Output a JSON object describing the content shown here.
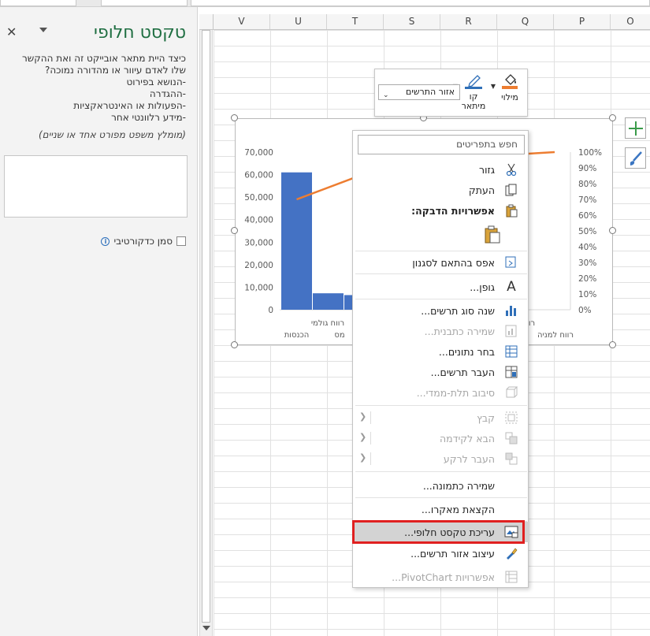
{
  "pane": {
    "title": "טקסט חלופי",
    "description_lines": [
      "כיצד היית מתאר אובייקט זה ואת ההקשר",
      "שלו לאדם עיוור או מהדורה נמוכה?",
      "-הנושא בפירוט",
      "-ההגדרה",
      "-הפעולות או האינטראקציות",
      "-מידע רלוונטי אחר"
    ],
    "hint": "(מומלץ משפט מפורט אחד או שניים)",
    "decorative_label": "סמן כדקורטיבי",
    "close_glyph": "✕"
  },
  "columns": [
    "V",
    "U",
    "T",
    "S",
    "R",
    "Q",
    "P",
    "O"
  ],
  "mini_toolbar": {
    "fill_label": "מילוי",
    "outline_label_1": "קו",
    "outline_label_2": "מיתאר",
    "element_select": "אזור התרשים"
  },
  "chart_data": {
    "type": "bar",
    "categories": [
      "הכנסות",
      "רווח גולמי",
      "מס",
      "רווח למניה"
    ],
    "values": [
      61000,
      7300,
      6500,
      null
    ],
    "line_series": {
      "values": [
        0.7,
        0.85,
        0.95,
        1.0
      ]
    },
    "ylim": [
      0,
      70000
    ],
    "y_ticks": [
      "0",
      "10,000",
      "20,000",
      "30,000",
      "40,000",
      "50,000",
      "60,000",
      "70,000"
    ],
    "y2_ticks": [
      "0%",
      "10%",
      "20%",
      "30%",
      "40%",
      "50%",
      "60%",
      "70%",
      "80%",
      "90%",
      "100%"
    ],
    "x_labels_visible": [
      "הכנסות",
      "רווח גולמי",
      "מס",
      "רווח למניה",
      "רו"
    ],
    "bar_color": "#4472c4",
    "line_color": "#ed7d31"
  },
  "context_menu": {
    "search_placeholder": "חפש בתפריטים",
    "items": {
      "cut": "גזור",
      "copy": "העתק",
      "paste_options": "אפשרויות הדבקה:",
      "reset_style": "אפס בהתאם לסגנון",
      "font": "גופן...",
      "change_type": "שנה סוג תרשים...",
      "save_template": "שמירה כתבנית...",
      "select_data": "בחר נתונים...",
      "move_chart": "העבר תרשים...",
      "rotate_3d": "סיבוב תלת-ממדי...",
      "group": "קבץ",
      "bring_forward": "הבא לקידמה",
      "send_backward": "העבר לרקע",
      "save_picture": "שמירה כתמונה...",
      "assign_macro": "הקצאת מאקרו...",
      "edit_alt_text": "עריכת טקסט חלופי...",
      "format_chart_area": "עיצוב אזור תרשים...",
      "pivot_options": "אפשרויות PivotChart..."
    }
  }
}
